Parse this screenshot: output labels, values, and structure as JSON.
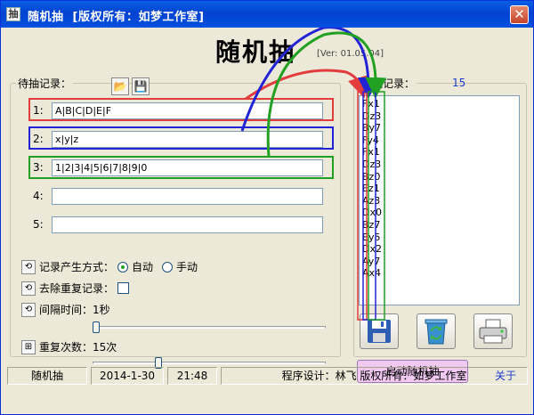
{
  "window": {
    "title": "随机抽  [版权所有：如梦工作室]",
    "close_glyph": "✕"
  },
  "header": {
    "title": "随机抽",
    "version": "[Ver: 01.05.04]"
  },
  "pending": {
    "legend": "待抽记录：",
    "rows": [
      {
        "num": "1:",
        "value": "A|B|C|D|E|F"
      },
      {
        "num": "2:",
        "value": "x|y|z"
      },
      {
        "num": "3:",
        "value": "1|2|3|4|5|6|7|8|9|0"
      },
      {
        "num": "4:",
        "value": ""
      },
      {
        "num": "5:",
        "value": ""
      }
    ]
  },
  "options": {
    "mode_label": "记录产生方式：",
    "mode_auto": "自动",
    "mode_manual": "手动",
    "mode_selected": "auto",
    "dedup_label": "去除重复记录：",
    "dedup_checked": false,
    "interval_label": "间隔时间：1秒",
    "interval_value_sec": 1,
    "repeat_label": "重复次数：15次",
    "repeat_value": 15
  },
  "drawn": {
    "legend": "已抽记录：",
    "count": "15",
    "items": [
      "Fx1",
      "Dz3",
      "By7",
      "Fy4",
      "Fx1",
      "Dz3",
      "Bz0",
      "Ez1",
      "Az3",
      "Dx0",
      "Bz7",
      "Ey5",
      "Dx2",
      "Ay7",
      "Ax4"
    ]
  },
  "actions": {
    "start_label": "启动随机抽",
    "about_label": "关于"
  },
  "statusbar": {
    "app": "随机抽",
    "date": "2014-1-30",
    "time": "21:48",
    "credits": "程序设计：林飞  版权所有：如梦工作室"
  },
  "colors": {
    "title_bg": "#0343d0",
    "highlight_red": "#e23c3c",
    "highlight_blue": "#2323d6",
    "highlight_green": "#22a022",
    "start_btn": "#f0c8f0",
    "about_link": "#1b3bcb"
  },
  "icons": [
    "app-icon",
    "open-folder-icon",
    "save-icon",
    "floppy-icon",
    "recycle-icon",
    "printer-icon",
    "option-icon"
  ]
}
